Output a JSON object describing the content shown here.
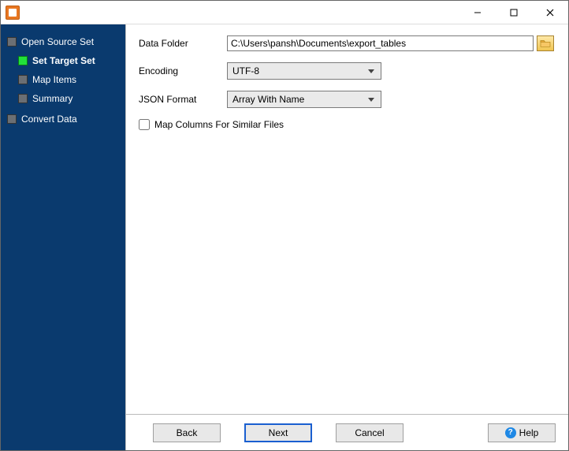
{
  "window": {
    "title": ""
  },
  "sidebar": {
    "root1": {
      "label": "Open Source Set",
      "children": [
        {
          "label": "Set Target Set",
          "current": true
        },
        {
          "label": "Map Items"
        },
        {
          "label": "Summary"
        }
      ]
    },
    "root2": {
      "label": "Convert Data"
    }
  },
  "form": {
    "dataFolder": {
      "label": "Data Folder",
      "value": "C:\\Users\\pansh\\Documents\\export_tables"
    },
    "encoding": {
      "label": "Encoding",
      "value": "UTF-8"
    },
    "jsonFormat": {
      "label": "JSON Format",
      "value": "Array With Name"
    },
    "mapColumns": {
      "label": "Map Columns For Similar Files",
      "checked": false
    }
  },
  "footer": {
    "back": "Back",
    "next": "Next",
    "cancel": "Cancel",
    "help": "Help"
  }
}
